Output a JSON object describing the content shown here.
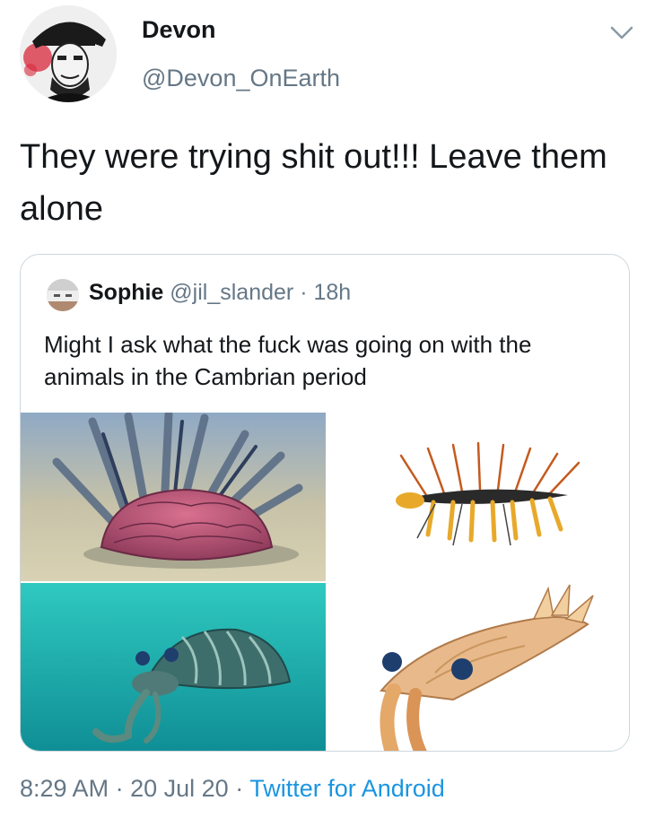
{
  "tweet": {
    "author": {
      "name": "Devon",
      "handle": "@Devon_OnEarth",
      "avatar_icon": "profile-avatar"
    },
    "text": "They were trying shit out!!! Leave them alone",
    "menu_icon": "chevron-down-icon"
  },
  "quoted_tweet": {
    "author": {
      "name": "Sophie",
      "handle": "@jil_slander",
      "separator": "·",
      "age": "18h"
    },
    "text": "Might I ask what the fuck was going on with the animals in the Cambrian period",
    "media": [
      {
        "icon": "spiny-creature-image"
      },
      {
        "icon": "hallucigenia-image"
      },
      {
        "icon": "anomalocaris-underwater-image"
      },
      {
        "icon": "anomalocaris-illustration-image"
      }
    ]
  },
  "footer": {
    "time": "8:29 AM",
    "separator1": "·",
    "date": "20 Jul 20",
    "separator2": "·",
    "source": "Twitter for Android"
  },
  "colors": {
    "text": "#14171a",
    "secondary": "#657786",
    "link": "#1b95e0",
    "border": "#ccd6dd"
  }
}
